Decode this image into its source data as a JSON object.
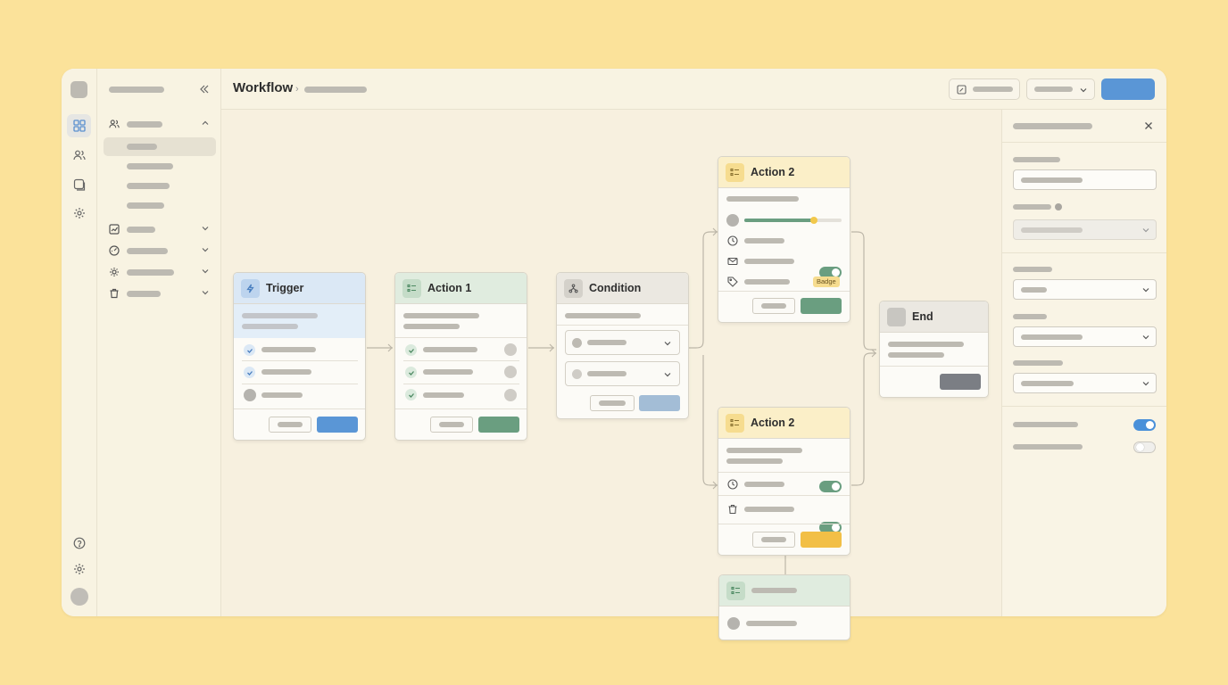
{
  "workflow": {
    "title": "Workflow"
  },
  "nodes": {
    "trigger": {
      "title": "Trigger"
    },
    "action1": {
      "title": "Action 1"
    },
    "condition": {
      "title": "Condition"
    },
    "action2_top": {
      "title": "Action 2",
      "badge": "Badge",
      "progress": 0.72
    },
    "action2_bottom": {
      "title": "Action 2"
    },
    "end": {
      "title": "End"
    }
  },
  "panel": {
    "toggles": [
      {
        "on": true
      },
      {
        "on": false
      }
    ]
  },
  "colors": {
    "background": "#fbe29a",
    "primary": "#5a96d6",
    "success": "#6a9e80",
    "warning": "#f2bf46",
    "badge_bg": "#f6dc8f"
  },
  "icons": {
    "rail": [
      "grid-icon",
      "users-icon",
      "layers-icon",
      "gear-icon",
      "help-icon",
      "settings-icon"
    ],
    "trigger": "lightning-icon",
    "action": "list-icon",
    "condition": "branch-icon"
  }
}
